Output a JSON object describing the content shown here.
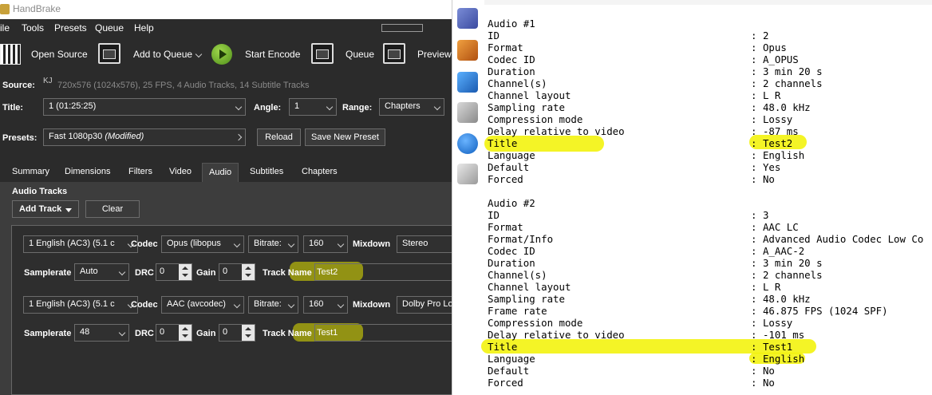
{
  "handbrake": {
    "window_title": "HandBrake",
    "menu": [
      "ile",
      "Tools",
      "Presets",
      "Queue",
      "Help"
    ],
    "toolbar": {
      "open_source": "Open Source",
      "add_to_queue": "Add to Queue",
      "start_encode": "Start Encode",
      "queue": "Queue",
      "preview": "Preview"
    },
    "source": {
      "label": "Source:",
      "name": "KJ",
      "info": "720x576 (1024x576), 25 FPS, 4 Audio Tracks, 14 Subtitle Tracks"
    },
    "title_row": {
      "title_label": "Title:",
      "title_value": "1 (01:25:25)",
      "angle_label": "Angle:",
      "angle_value": "1",
      "range_label": "Range:",
      "range_value": "Chapters"
    },
    "presets_row": {
      "label": "Presets:",
      "value": "Fast 1080p30",
      "modified": "(Modified)",
      "reload": "Reload",
      "save_new": "Save New Preset"
    },
    "tabs": [
      "Summary",
      "Dimensions",
      "Filters",
      "Video",
      "Audio",
      "Subtitles",
      "Chapters"
    ],
    "active_tab": "Audio",
    "audio": {
      "section_title": "Audio Tracks",
      "add_track": "Add Track",
      "clear": "Clear",
      "labels": {
        "codec": "Codec",
        "bitrate": "Bitrate:",
        "mixdown": "Mixdown",
        "samplerate": "Samplerate",
        "drc": "DRC",
        "gain": "Gain",
        "track_name": "Track Name"
      },
      "tracks": [
        {
          "source": "1 English (AC3) (5.1 c",
          "codec": "Opus (libopus",
          "bitrate_mode": "Bitrate:",
          "bitrate": "160",
          "mixdown": "Stereo",
          "samplerate": "Auto",
          "drc": "0",
          "gain": "0",
          "track_name": "Test2"
        },
        {
          "source": "1 English (AC3) (5.1 c",
          "codec": "AAC (avcodec)",
          "bitrate_mode": "Bitrate:",
          "bitrate": "160",
          "mixdown": "Dolby Pro Lo",
          "samplerate": "48",
          "drc": "0",
          "gain": "0",
          "track_name": "Test1"
        }
      ]
    }
  },
  "mediainfo": {
    "blocks": [
      {
        "header": "Audio #1",
        "rows": [
          [
            "ID",
            "2"
          ],
          [
            "Format",
            "Opus"
          ],
          [
            "Codec ID",
            "A_OPUS"
          ],
          [
            "Duration",
            "3 min 20 s"
          ],
          [
            "Channel(s)",
            "2 channels"
          ],
          [
            "Channel layout",
            "L R"
          ],
          [
            "Sampling rate",
            "48.0 kHz"
          ],
          [
            "Compression mode",
            "Lossy"
          ],
          [
            "Delay relative to video",
            "-87 ms"
          ],
          [
            "Title",
            "Test2"
          ],
          [
            "Language",
            "English"
          ],
          [
            "Default",
            "Yes"
          ],
          [
            "Forced",
            "No"
          ]
        ]
      },
      {
        "header": "Audio #2",
        "rows": [
          [
            "ID",
            "3"
          ],
          [
            "Format",
            "AAC LC"
          ],
          [
            "Format/Info",
            "Advanced Audio Codec Low Co"
          ],
          [
            "Codec ID",
            "A_AAC-2"
          ],
          [
            "Duration",
            "3 min 20 s"
          ],
          [
            "Channel(s)",
            "2 channels"
          ],
          [
            "Channel layout",
            "L R"
          ],
          [
            "Sampling rate",
            "48.0 kHz"
          ],
          [
            "Frame rate",
            "46.875 FPS (1024 SPF)"
          ],
          [
            "Compression mode",
            "Lossy"
          ],
          [
            "Delay relative to video",
            "-101 ms"
          ],
          [
            "Title",
            "Test1"
          ],
          [
            "Language",
            "English"
          ],
          [
            "Default",
            "No"
          ],
          [
            "Forced",
            "No"
          ]
        ]
      }
    ],
    "separator": ":"
  },
  "colors": {
    "highlight": "#f2f200",
    "hb_background": "#2b2b2b",
    "hb_panel": "#3d3d3d"
  }
}
